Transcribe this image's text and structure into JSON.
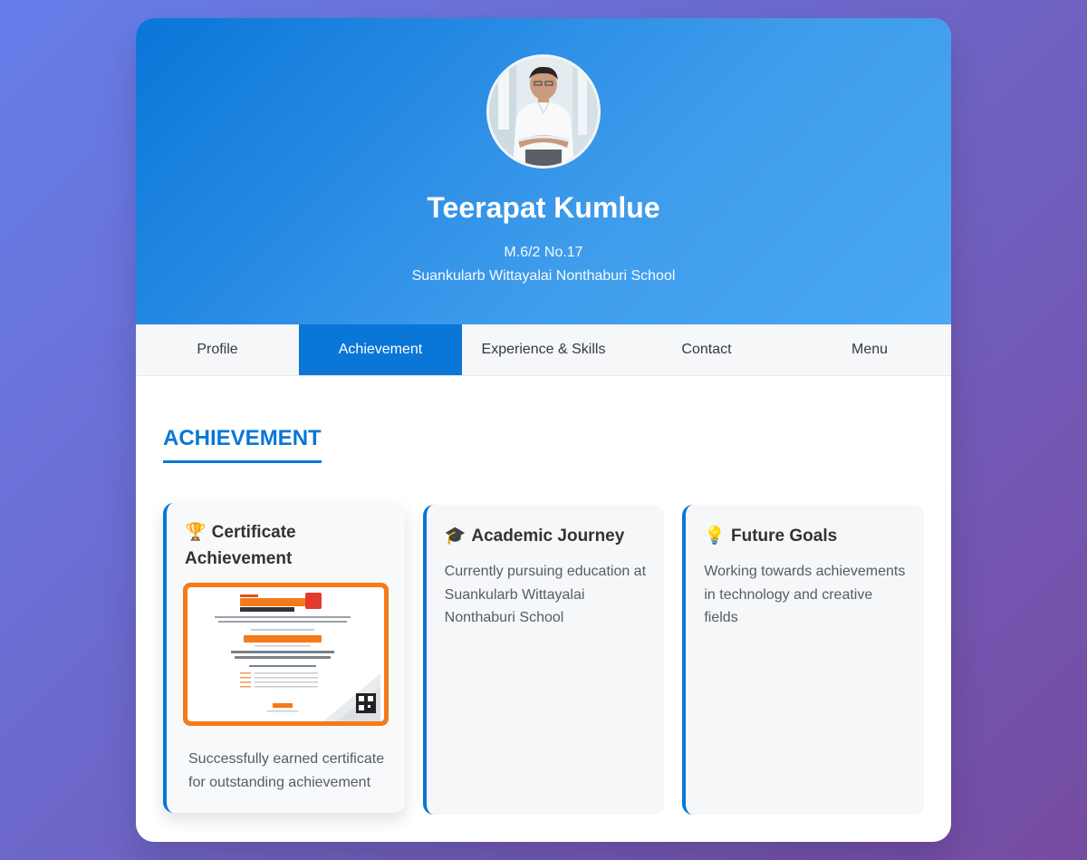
{
  "profile": {
    "name": "Teerapat Kumlue",
    "class_info": "M.6/2 No.17",
    "school": "Suankularb Wittayalai Nonthaburi School"
  },
  "nav": {
    "items": [
      {
        "label": "Profile",
        "active": false
      },
      {
        "label": "Achievement",
        "active": true
      },
      {
        "label": "Experience & Skills",
        "active": false
      },
      {
        "label": "Contact",
        "active": false
      },
      {
        "label": "Menu",
        "active": false
      }
    ]
  },
  "section": {
    "title": "ACHIEVEMENT"
  },
  "cards": [
    {
      "icon": "trophy-icon",
      "emoji": "🏆",
      "title": "Certificate Achievement",
      "text": "Successfully earned certificate for outstanding achievement",
      "certificate": {
        "brand": "Dek-D's",
        "headline": "Pre-Admission",
        "badge": "TCAS 69",
        "recipient": "นายธีรภัทร คำลือ",
        "score_line": "ได้คะแนนสอบ TGAT 192.08 จาก 300 คะแนน",
        "footer": "Dek-D"
      }
    },
    {
      "icon": "graduation-cap-icon",
      "emoji": "🎓",
      "title": "Academic Journey",
      "text": "Currently pursuing education at Suankularb Wittayalai Nonthaburi School"
    },
    {
      "icon": "lightbulb-icon",
      "emoji": "💡",
      "title": "Future Goals",
      "text": "Working towards achievements in technology and creative fields"
    }
  ],
  "colors": {
    "accent": "#0a76d8",
    "background_start": "#667eea",
    "background_end": "#764ba2",
    "certificate_orange": "#f47a1a"
  }
}
